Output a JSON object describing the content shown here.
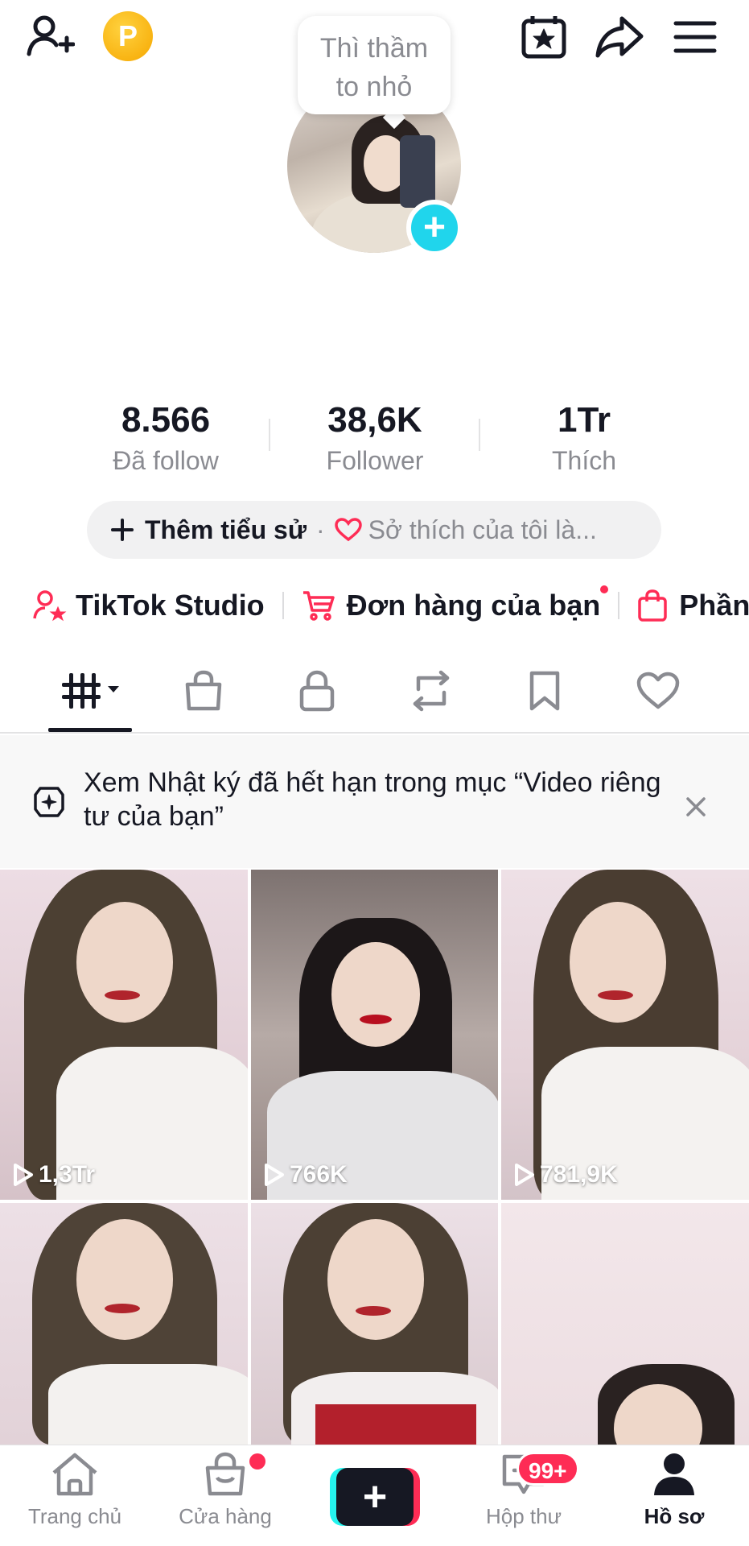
{
  "header": {
    "tooltip": "Thì thầm to nhỏ",
    "coin_letter": "P",
    "icons": [
      "add-friend-icon",
      "coin-icon",
      "calendar-star-icon",
      "share-icon",
      "menu-icon"
    ]
  },
  "stats": [
    {
      "value": "8.566",
      "label": "Đã follow"
    },
    {
      "value": "38,6K",
      "label": "Follower"
    },
    {
      "value": "1Tr",
      "label": "Thích"
    }
  ],
  "bio": {
    "add_label": "Thêm tiểu sử",
    "separator": "·",
    "hobby_placeholder": "Sở thích của tôi là..."
  },
  "shortcuts": [
    {
      "label": "TikTok Studio",
      "icon": "user-star-icon"
    },
    {
      "label": "Đơn hàng của bạn",
      "icon": "cart-icon"
    },
    {
      "label": "Phần",
      "icon": "bag-icon"
    }
  ],
  "tabs": [
    "videos-grid-icon",
    "shop-bag-icon",
    "lock-icon",
    "repost-icon",
    "bookmark-icon",
    "heart-icon"
  ],
  "notice": {
    "text": "Xem Nhật ký đã hết hạn trong mục “Video riêng tư của bạn”"
  },
  "videos": [
    {
      "views": "1,3Tr"
    },
    {
      "views": "766K"
    },
    {
      "views": "781,9K"
    },
    {
      "views": ""
    },
    {
      "views": ""
    },
    {
      "views": ""
    }
  ],
  "bottom_nav": {
    "home": "Trang chủ",
    "shop": "Cửa hàng",
    "inbox": "Hộp thư",
    "inbox_badge": "99+",
    "profile": "Hồ sơ",
    "create": "+"
  },
  "colors": {
    "accent_red": "#fe2c55",
    "accent_cyan": "#20d5ec",
    "text_primary": "#161823",
    "text_secondary": "#8a8b91"
  }
}
